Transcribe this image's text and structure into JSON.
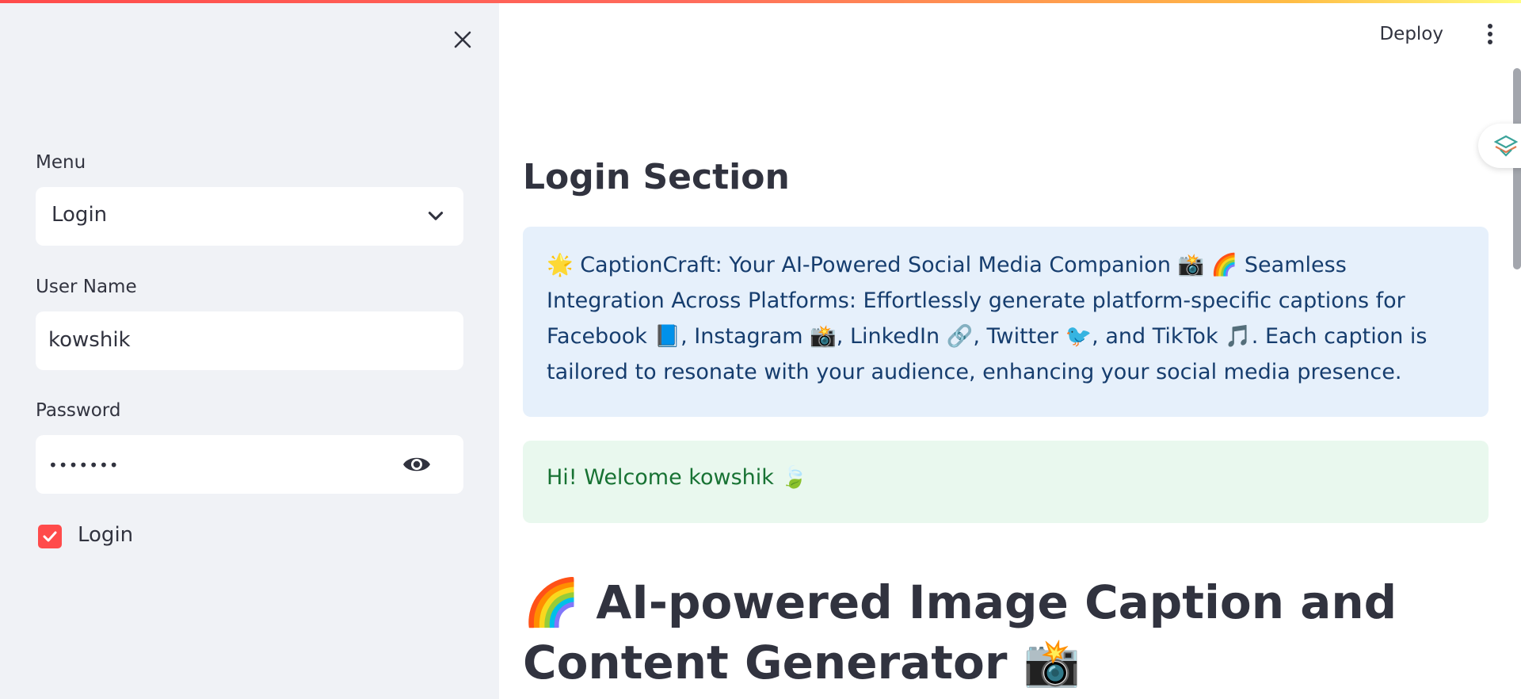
{
  "sidebar": {
    "menu_label": "Menu",
    "menu_selected": "Login",
    "username_label": "User Name",
    "username_value": "kowshik",
    "password_label": "Password",
    "password_mask": "•••••••",
    "login_checkbox_label": "Login",
    "login_checked": true
  },
  "header": {
    "deploy_label": "Deploy"
  },
  "main": {
    "title": "Login Section",
    "info_text": "🌟 CaptionCraft: Your AI-Powered Social Media Companion 📸 🌈 Seamless Integration Across Platforms: Effortlessly generate platform-specific captions for Facebook 📘, Instagram 📸, LinkedIn 🔗, Twitter 🐦, and TikTok 🎵. Each caption is tailored to resonate with your audience, enhancing your social media presence.",
    "success_text": "Hi! Welcome kowshik 🍃",
    "heading": "🌈 AI-powered Image Caption and Content Generator 📸"
  },
  "icons": {
    "close": "close-icon",
    "chevron": "chevron-down-icon",
    "eye": "eye-icon",
    "check": "check-icon",
    "kebab": "more-vert-icon"
  },
  "colors": {
    "accent": "#ff4b4b",
    "sidebar_bg": "#f0f2f6",
    "info_bg": "#e6f0fb",
    "info_text": "#163d6e",
    "success_bg": "#e9f8ee",
    "success_text": "#177233"
  }
}
